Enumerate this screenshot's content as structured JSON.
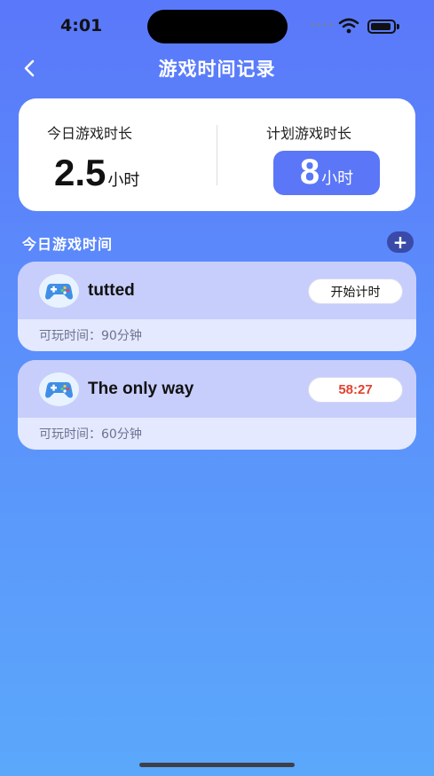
{
  "status_bar": {
    "time": "4:01"
  },
  "nav": {
    "title": "游戏时间记录"
  },
  "summary": {
    "today_label": "今日游戏时长",
    "today_value": "2.5",
    "today_unit": "小时",
    "plan_label": "计划游戏时长",
    "plan_value": "8",
    "plan_unit": "小时"
  },
  "section": {
    "title": "今日游戏时间",
    "add_label": "+"
  },
  "games": [
    {
      "name": "tutted",
      "action": "开始计时",
      "allowed": "可玩时间：90分钟"
    },
    {
      "name": "The only way",
      "action": "58:27",
      "allowed": "可玩时间：60分钟"
    }
  ],
  "colors": {
    "accent": "#5b76f7",
    "card_header": "#c7cefc",
    "timer_running": "#e0432f"
  }
}
